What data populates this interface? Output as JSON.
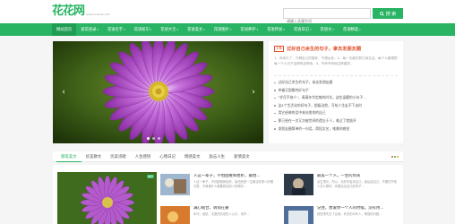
{
  "header": {
    "logo_text": "花花网",
    "logo_sub": "www.huahua.com",
    "search_placeholder": "请输入关键字词",
    "search_button": "搜 索"
  },
  "nav": {
    "items": [
      {
        "label": "网站首页",
        "caret": ""
      },
      {
        "label": "爱花语录",
        "caret": "▾"
      },
      {
        "label": "花语名字",
        "caret": "▾"
      },
      {
        "label": "花语知识",
        "caret": "▾"
      },
      {
        "label": "花语大全",
        "caret": "▾"
      },
      {
        "label": "花语美文",
        "caret": "▾"
      },
      {
        "label": "花语图片",
        "caret": "▾"
      },
      {
        "label": "花语养护",
        "caret": "▾"
      },
      {
        "label": "花语传说",
        "caret": "▾"
      },
      {
        "label": "花语日记",
        "caret": "▾"
      },
      {
        "label": "花语文",
        "caret": "▾"
      },
      {
        "label": "花语精选",
        "caret": "▾"
      }
    ]
  },
  "slider": {
    "prev_arrow": "‹",
    "next_arrow": "›",
    "caption_1": "",
    "caption_2": "",
    "colors": {
      "petal": "#a63bbd",
      "petal_light": "#d58ae6",
      "center": "#e8c832",
      "bg": "#2d4a14"
    }
  },
  "side": {
    "badge": "头条",
    "top_title": "过好自己余生的句子，拿去发朋友圈",
    "top_desc": "1、时间久了，只剩自己的陪伴，不想太多。2、每一天都在努力地生活，每个人都想把每一个小日子活得有滋有味。3、不声不响地过得更好。",
    "list": [
      "过好自己余生的句子，拿去发朋友圈",
      "幸福又甜蜜的好句子",
      "\"岁月不饶人\"，青春年华定格的时光，这些温暖的小句子…",
      "这4个生活化的好句子，超级治愈，写给人生走不下去时",
      "用它经典的话中来治愈你的自己",
      "那已经在一次又次被世间的遗忘于人，难过了就放开",
      "发朋友圈简单的一句话，简短文艺，唯美的感觉"
    ]
  },
  "tabs": {
    "items": [
      "随笔美文",
      "优美散文",
      "优美诗歌",
      "人生感悟",
      "心情日记",
      "情感美文",
      "励志人生",
      "爱情美文"
    ],
    "dot_colors": [
      "#e0522d",
      "#28b463",
      "#f0a020"
    ]
  },
  "cards": {
    "feature_tag": "推荐",
    "items": [
      {
        "title": "人这一辈子，不怕困难和挫折，最怕…",
        "text": "人这一辈子，不怕困难和挫折，最怕的是一生都活在别人的眼光里，不管做什么都要顾及别人的眼光…"
      },
      {
        "title": "最美一个人，一生的到来",
        "text": "余生很长，所以，请好好善待自己，最后给自己，不要在乎别人怎么看你，你要活出自己的样子…"
      },
      {
        "title": "满心缝合，转雨在霎",
        "text": "年代，谁说，无数的情感在人心中，情怀…"
      },
      {
        "title": "记住，想爱你一个人的时候，没有用…",
        "text": "就觉得失去了自我，有关的中年人，等感情问题…"
      }
    ]
  }
}
